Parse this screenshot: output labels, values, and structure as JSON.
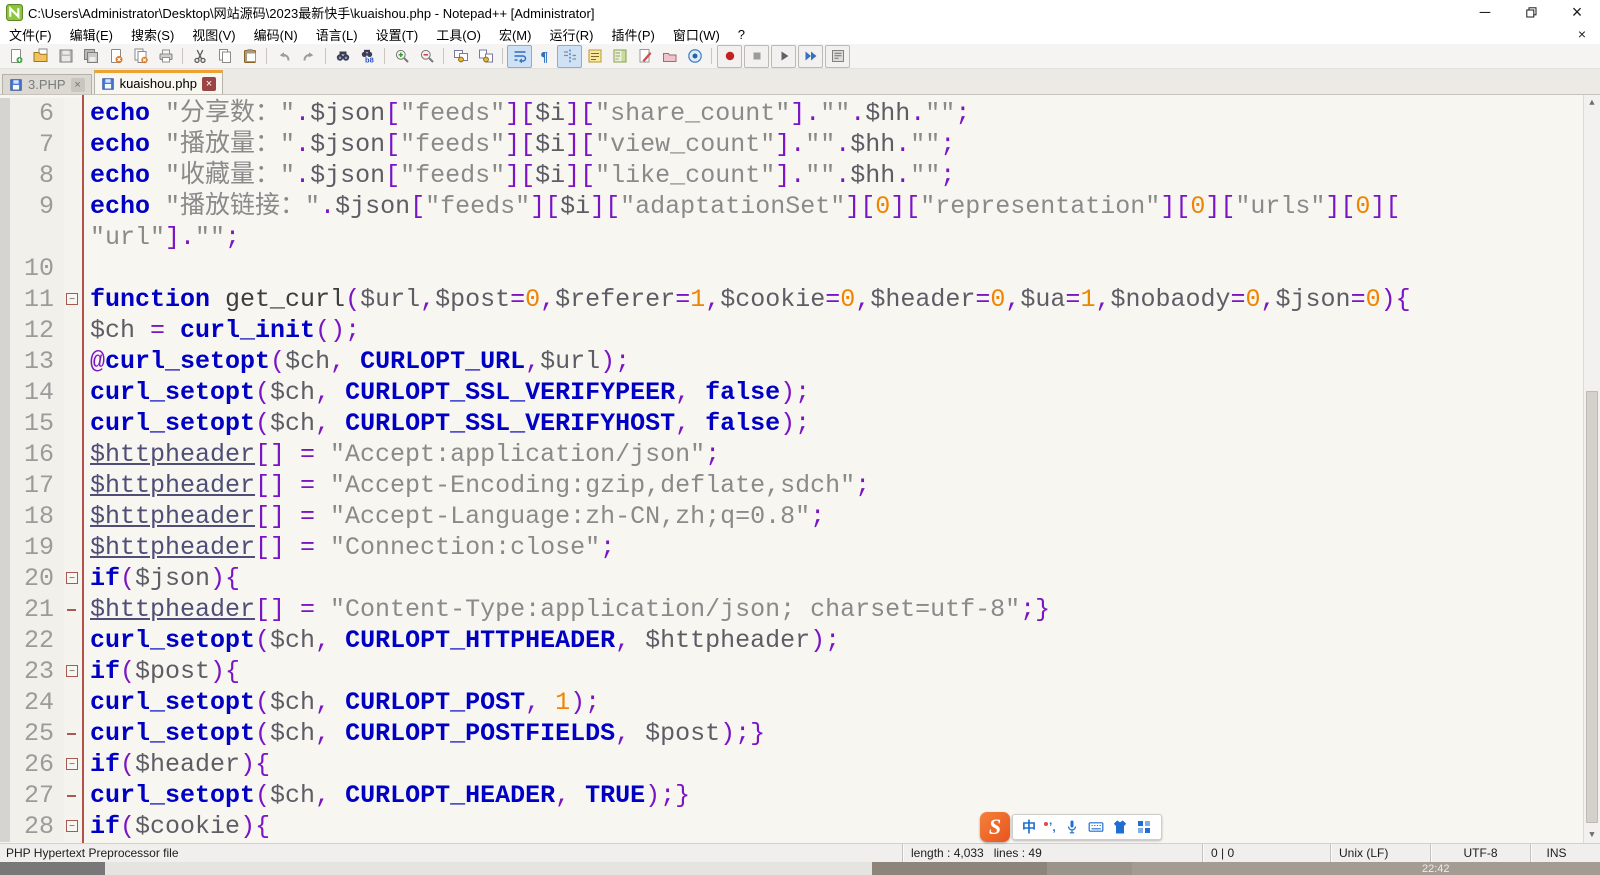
{
  "window": {
    "title": "C:\\Users\\Administrator\\Desktop\\网站源码\\2023最新快手\\kuaishou.php - Notepad++ [Administrator]",
    "controls": {
      "minimize": "─",
      "restore": "restore",
      "close": "×"
    }
  },
  "menu": {
    "items": [
      "文件(F)",
      "编辑(E)",
      "搜索(S)",
      "视图(V)",
      "编码(N)",
      "语言(L)",
      "设置(T)",
      "工具(O)",
      "宏(M)",
      "运行(R)",
      "插件(P)",
      "窗口(W)",
      "?"
    ],
    "close_label": "×"
  },
  "toolbar": {
    "icons": [
      {
        "n": "new-file"
      },
      {
        "n": "open-file"
      },
      {
        "n": "save"
      },
      {
        "n": "save-all"
      },
      {
        "n": "close-file"
      },
      {
        "n": "close-all"
      },
      {
        "n": "print"
      },
      {
        "sep": true
      },
      {
        "n": "cut"
      },
      {
        "n": "copy"
      },
      {
        "n": "paste"
      },
      {
        "sep": true
      },
      {
        "n": "undo"
      },
      {
        "n": "redo"
      },
      {
        "sep": true
      },
      {
        "n": "find"
      },
      {
        "n": "replace"
      },
      {
        "sep": true
      },
      {
        "n": "zoom-in"
      },
      {
        "n": "zoom-out"
      },
      {
        "sep": true
      },
      {
        "n": "sync-scroll-vertical"
      },
      {
        "n": "sync-scroll-horizontal"
      },
      {
        "sep": true
      },
      {
        "n": "word-wrap",
        "active": true
      },
      {
        "n": "show-all-chars"
      },
      {
        "n": "indent-guide",
        "active": true
      },
      {
        "n": "function-list"
      },
      {
        "n": "doc-map"
      },
      {
        "n": "doc-switcher"
      },
      {
        "n": "folder-workspace"
      },
      {
        "n": "monitoring"
      },
      {
        "sep": true
      },
      {
        "n": "macro-record",
        "boxed": true
      },
      {
        "n": "macro-stop",
        "boxed": true
      },
      {
        "n": "macro-play",
        "boxed": true
      },
      {
        "n": "macro-run-multi",
        "boxed": true
      },
      {
        "n": "macro-save",
        "boxed": true
      }
    ]
  },
  "tabs": [
    {
      "label": "3.PHP",
      "active": false,
      "close": "×"
    },
    {
      "label": "kuaishou.php",
      "active": true,
      "close": "×"
    }
  ],
  "editor": {
    "rows": [
      {
        "num": "6",
        "fold": "none",
        "tokens": [
          [
            "k",
            "echo "
          ],
          [
            "s",
            "\"分享数："
          ],
          [
            "s",
            "\""
          ],
          [
            "o",
            "."
          ],
          [
            "v",
            "$json"
          ],
          [
            "o",
            "["
          ],
          [
            "s",
            "\"feeds\""
          ],
          [
            "o",
            "]["
          ],
          [
            "v",
            "$i"
          ],
          [
            "o",
            "]["
          ],
          [
            "s",
            "\"share_count\""
          ],
          [
            "o",
            "]."
          ],
          [
            "s",
            "\"\""
          ],
          [
            "o",
            "."
          ],
          [
            "v",
            "$hh"
          ],
          [
            "o",
            "."
          ],
          [
            "s",
            "\"\""
          ],
          [
            "o",
            ";"
          ]
        ]
      },
      {
        "num": "7",
        "fold": "none",
        "tokens": [
          [
            "k",
            "echo "
          ],
          [
            "s",
            "\"播放量："
          ],
          [
            "s",
            "\""
          ],
          [
            "o",
            "."
          ],
          [
            "v",
            "$json"
          ],
          [
            "o",
            "["
          ],
          [
            "s",
            "\"feeds\""
          ],
          [
            "o",
            "]["
          ],
          [
            "v",
            "$i"
          ],
          [
            "o",
            "]["
          ],
          [
            "s",
            "\"view_count\""
          ],
          [
            "o",
            "]."
          ],
          [
            "s",
            "\"\""
          ],
          [
            "o",
            "."
          ],
          [
            "v",
            "$hh"
          ],
          [
            "o",
            "."
          ],
          [
            "s",
            "\"\""
          ],
          [
            "o",
            ";"
          ]
        ]
      },
      {
        "num": "8",
        "fold": "none",
        "tokens": [
          [
            "k",
            "echo "
          ],
          [
            "s",
            "\"收藏量："
          ],
          [
            "s",
            "\""
          ],
          [
            "o",
            "."
          ],
          [
            "v",
            "$json"
          ],
          [
            "o",
            "["
          ],
          [
            "s",
            "\"feeds\""
          ],
          [
            "o",
            "]["
          ],
          [
            "v",
            "$i"
          ],
          [
            "o",
            "]["
          ],
          [
            "s",
            "\"like_count\""
          ],
          [
            "o",
            "]."
          ],
          [
            "s",
            "\"\""
          ],
          [
            "o",
            "."
          ],
          [
            "v",
            "$hh"
          ],
          [
            "o",
            "."
          ],
          [
            "s",
            "\"\""
          ],
          [
            "o",
            ";"
          ]
        ]
      },
      {
        "num": "9",
        "fold": "none",
        "tokens": [
          [
            "k",
            "echo "
          ],
          [
            "s",
            "\"播放链接："
          ],
          [
            "s",
            "\""
          ],
          [
            "o",
            "."
          ],
          [
            "v",
            "$json"
          ],
          [
            "o",
            "["
          ],
          [
            "s",
            "\"feeds\""
          ],
          [
            "o",
            "]["
          ],
          [
            "v",
            "$i"
          ],
          [
            "o",
            "]["
          ],
          [
            "s",
            "\"adaptationSet\""
          ],
          [
            "o",
            "]["
          ],
          [
            "n",
            "0"
          ],
          [
            "o",
            "]["
          ],
          [
            "s",
            "\"representation\""
          ],
          [
            "o",
            "]["
          ],
          [
            "n",
            "0"
          ],
          [
            "o",
            "]["
          ],
          [
            "s",
            "\"urls\""
          ],
          [
            "o",
            "]["
          ],
          [
            "n",
            "0"
          ],
          [
            "o",
            "]["
          ]
        ]
      },
      {
        "num": "",
        "fold": "none",
        "tokens": [
          [
            "s",
            "\"url\""
          ],
          [
            "o",
            "]."
          ],
          [
            "s",
            "\"\""
          ],
          [
            "o",
            ";"
          ]
        ]
      },
      {
        "num": "10",
        "fold": "none",
        "tokens": []
      },
      {
        "num": "11",
        "fold": "box",
        "tokens": [
          [
            "k",
            "function "
          ],
          [
            "d",
            "get_curl"
          ],
          [
            "o",
            "("
          ],
          [
            "v",
            "$url"
          ],
          [
            "o",
            ","
          ],
          [
            "v",
            "$post"
          ],
          [
            "o",
            "="
          ],
          [
            "n",
            "0"
          ],
          [
            "o",
            ","
          ],
          [
            "v",
            "$referer"
          ],
          [
            "o",
            "="
          ],
          [
            "n",
            "1"
          ],
          [
            "o",
            ","
          ],
          [
            "v",
            "$cookie"
          ],
          [
            "o",
            "="
          ],
          [
            "n",
            "0"
          ],
          [
            "o",
            ","
          ],
          [
            "v",
            "$header"
          ],
          [
            "o",
            "="
          ],
          [
            "n",
            "0"
          ],
          [
            "o",
            ","
          ],
          [
            "v",
            "$ua"
          ],
          [
            "o",
            "="
          ],
          [
            "n",
            "1"
          ],
          [
            "o",
            ","
          ],
          [
            "v",
            "$nobaody"
          ],
          [
            "o",
            "="
          ],
          [
            "n",
            "0"
          ],
          [
            "o",
            ","
          ],
          [
            "v",
            "$json"
          ],
          [
            "o",
            "="
          ],
          [
            "n",
            "0"
          ],
          [
            "o",
            "){"
          ]
        ]
      },
      {
        "num": "12",
        "fold": "none",
        "tokens": [
          [
            "v",
            "$ch "
          ],
          [
            "o",
            "= "
          ],
          [
            "k",
            "curl_init"
          ],
          [
            "o",
            "();"
          ]
        ]
      },
      {
        "num": "13",
        "fold": "none",
        "tokens": [
          [
            "o",
            "@"
          ],
          [
            "k",
            "curl_setopt"
          ],
          [
            "o",
            "("
          ],
          [
            "v",
            "$ch"
          ],
          [
            "o",
            ", "
          ],
          [
            "k",
            "CURLOPT_URL"
          ],
          [
            "o",
            ","
          ],
          [
            "v",
            "$url"
          ],
          [
            "o",
            ");"
          ]
        ]
      },
      {
        "num": "14",
        "fold": "none",
        "tokens": [
          [
            "k",
            "curl_setopt"
          ],
          [
            "o",
            "("
          ],
          [
            "v",
            "$ch"
          ],
          [
            "o",
            ", "
          ],
          [
            "k",
            "CURLOPT_SSL_VERIFYPEER"
          ],
          [
            "o",
            ", "
          ],
          [
            "k",
            "false"
          ],
          [
            "o",
            ");"
          ]
        ]
      },
      {
        "num": "15",
        "fold": "none",
        "tokens": [
          [
            "k",
            "curl_setopt"
          ],
          [
            "o",
            "("
          ],
          [
            "v",
            "$ch"
          ],
          [
            "o",
            ", "
          ],
          [
            "k",
            "CURLOPT_SSL_VERIFYHOST"
          ],
          [
            "o",
            ", "
          ],
          [
            "k",
            "false"
          ],
          [
            "o",
            ");"
          ]
        ]
      },
      {
        "num": "16",
        "fold": "none",
        "tokens": [
          [
            "vu",
            "$httpheader"
          ],
          [
            "o",
            "[] = "
          ],
          [
            "s",
            "\"Accept:application/json\""
          ],
          [
            "o",
            ";"
          ]
        ]
      },
      {
        "num": "17",
        "fold": "none",
        "tokens": [
          [
            "vu",
            "$httpheader"
          ],
          [
            "o",
            "[] = "
          ],
          [
            "s",
            "\"Accept-Encoding:gzip,deflate,sdch\""
          ],
          [
            "o",
            ";"
          ]
        ]
      },
      {
        "num": "18",
        "fold": "none",
        "tokens": [
          [
            "vu",
            "$httpheader"
          ],
          [
            "o",
            "[] = "
          ],
          [
            "s",
            "\"Accept-Language:zh-CN,zh;q=0.8\""
          ],
          [
            "o",
            ";"
          ]
        ]
      },
      {
        "num": "19",
        "fold": "none",
        "tokens": [
          [
            "vu",
            "$httpheader"
          ],
          [
            "o",
            "[] = "
          ],
          [
            "s",
            "\"Connection:close\""
          ],
          [
            "o",
            ";"
          ]
        ]
      },
      {
        "num": "20",
        "fold": "box",
        "tokens": [
          [
            "k",
            "if"
          ],
          [
            "o",
            "("
          ],
          [
            "v",
            "$json"
          ],
          [
            "o",
            "){"
          ]
        ]
      },
      {
        "num": "21",
        "fold": "tick",
        "tokens": [
          [
            "vu",
            "$httpheader"
          ],
          [
            "o",
            "[] = "
          ],
          [
            "s",
            "\"Content-Type:application/json; charset=utf-8\""
          ],
          [
            "o",
            ";}"
          ]
        ]
      },
      {
        "num": "22",
        "fold": "none",
        "tokens": [
          [
            "k",
            "curl_setopt"
          ],
          [
            "o",
            "("
          ],
          [
            "v",
            "$ch"
          ],
          [
            "o",
            ", "
          ],
          [
            "k",
            "CURLOPT_HTTPHEADER"
          ],
          [
            "o",
            ", "
          ],
          [
            "v",
            "$httpheader"
          ],
          [
            "o",
            ");"
          ]
        ]
      },
      {
        "num": "23",
        "fold": "box",
        "tokens": [
          [
            "k",
            "if"
          ],
          [
            "o",
            "("
          ],
          [
            "v",
            "$post"
          ],
          [
            "o",
            "){"
          ]
        ]
      },
      {
        "num": "24",
        "fold": "none",
        "tokens": [
          [
            "k",
            "curl_setopt"
          ],
          [
            "o",
            "("
          ],
          [
            "v",
            "$ch"
          ],
          [
            "o",
            ", "
          ],
          [
            "k",
            "CURLOPT_POST"
          ],
          [
            "o",
            ", "
          ],
          [
            "n",
            "1"
          ],
          [
            "o",
            ");"
          ]
        ]
      },
      {
        "num": "25",
        "fold": "tick",
        "tokens": [
          [
            "k",
            "curl_setopt"
          ],
          [
            "o",
            "("
          ],
          [
            "v",
            "$ch"
          ],
          [
            "o",
            ", "
          ],
          [
            "k",
            "CURLOPT_POSTFIELDS"
          ],
          [
            "o",
            ", "
          ],
          [
            "v",
            "$post"
          ],
          [
            "o",
            ");}"
          ]
        ]
      },
      {
        "num": "26",
        "fold": "box",
        "tokens": [
          [
            "k",
            "if"
          ],
          [
            "o",
            "("
          ],
          [
            "v",
            "$header"
          ],
          [
            "o",
            "){"
          ]
        ]
      },
      {
        "num": "27",
        "fold": "tick",
        "tokens": [
          [
            "k",
            "curl_setopt"
          ],
          [
            "o",
            "("
          ],
          [
            "v",
            "$ch"
          ],
          [
            "o",
            ", "
          ],
          [
            "k",
            "CURLOPT_HEADER"
          ],
          [
            "o",
            ", "
          ],
          [
            "k",
            "TRUE"
          ],
          [
            "o",
            ");}"
          ]
        ]
      },
      {
        "num": "28",
        "fold": "box",
        "tokens": [
          [
            "k",
            "if"
          ],
          [
            "o",
            "("
          ],
          [
            "v",
            "$cookie"
          ],
          [
            "o",
            "){"
          ]
        ]
      }
    ]
  },
  "statusbar": {
    "doc_type": "PHP Hypertext Preprocessor file",
    "length_lines": "length : 4,033   lines : 49",
    "selection": "0 | 0",
    "eol": "Unix (LF)",
    "encoding": "UTF-8",
    "ins_mode": "INS"
  },
  "ime": {
    "logo": "S",
    "lang": "中",
    "punct": "’,"
  },
  "taskbar": {
    "clock": "22:42"
  },
  "colors": {
    "accent_tab": "#f0a230",
    "keyword": "#0000c4",
    "string": "#8a8a8a",
    "number": "#ef8400",
    "operator": "#7a14c4",
    "fold_line": "#b1524a",
    "ime_orange": "#e8541e",
    "ime_blue": "#1f6fd0"
  }
}
